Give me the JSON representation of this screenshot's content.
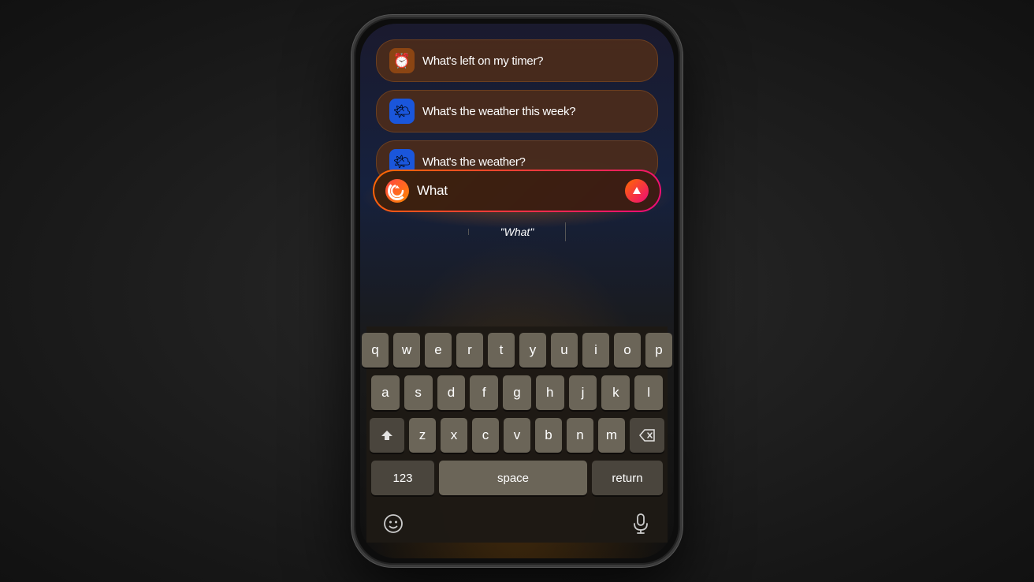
{
  "scene": {
    "bg_color": "#1a1a1a"
  },
  "suggestions": [
    {
      "id": "timer",
      "icon": "⏰",
      "icon_bg": "#8B4513",
      "text": "What's left on my timer?"
    },
    {
      "id": "weather_week",
      "icon": "🌤",
      "icon_bg": "#4169E1",
      "text": "What's the weather this week?"
    },
    {
      "id": "weather",
      "icon": "🌤",
      "icon_bg": "#4169E1",
      "text": "What's the weather?"
    }
  ],
  "siri_input": {
    "placeholder": "What",
    "current_text": "What",
    "send_button_label": "Send"
  },
  "autocomplete": {
    "left": "",
    "center": "\"What\"",
    "right": ""
  },
  "keyboard": {
    "rows": [
      [
        "q",
        "w",
        "e",
        "r",
        "t",
        "y",
        "u",
        "i",
        "o",
        "p"
      ],
      [
        "a",
        "s",
        "d",
        "f",
        "g",
        "h",
        "j",
        "k",
        "l"
      ],
      [
        "shift",
        "z",
        "x",
        "c",
        "v",
        "b",
        "n",
        "m",
        "delete"
      ]
    ],
    "bottom_row": {
      "numbers_label": "123",
      "space_label": "space",
      "return_label": "return"
    },
    "emoji_icon": "😊",
    "mic_icon": "🎤"
  }
}
